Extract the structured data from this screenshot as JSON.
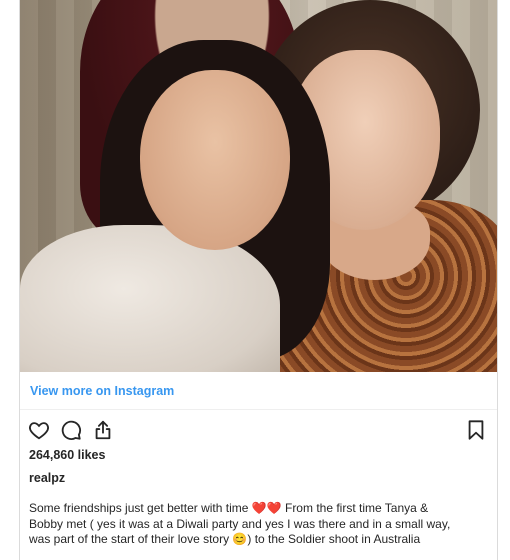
{
  "post": {
    "view_more": "View more on Instagram",
    "likes": "264,860 likes",
    "username": "realpz",
    "caption": "Some friendships just get better with time ❤️❤️ From the first time Tanya &\nBobby met ( yes it was at a Diwali party and yes I was there and in a small way,\nwas part of the start of their love story 😊) to the Soldier shoot in Australia"
  },
  "icons": {
    "like": "heart-icon",
    "comment": "comment-icon",
    "share": "share-icon",
    "save": "bookmark-icon"
  },
  "colors": {
    "link": "#3897f0",
    "text": "#262626",
    "border": "#dbdbdb"
  }
}
